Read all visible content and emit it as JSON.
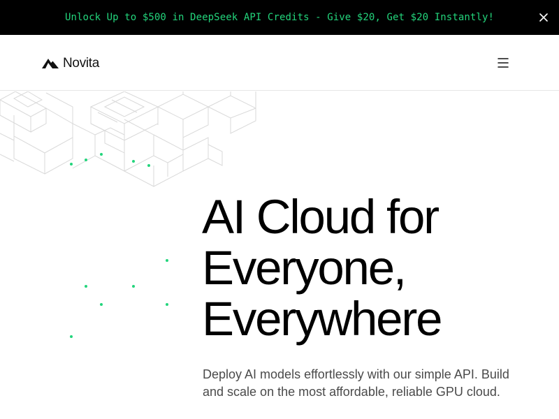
{
  "promo": {
    "text": "Unlock Up to $500 in DeepSeek API Credits - Give $20, Get $20 Instantly!",
    "close_icon": "close-icon",
    "text_color": "#23d57c",
    "background": "#000000"
  },
  "nav": {
    "logo_text": "Novita",
    "logo_icon": "mountain-logo-icon",
    "menu_icon": "hamburger-menu-icon"
  },
  "hero": {
    "title_lines": [
      "AI Cloud for",
      "Everyone,",
      "Everywhere"
    ],
    "subtitle_lines": [
      "Deploy AI models effortlessly with our simple API. Build",
      "and scale on the most affordable, reliable GPU cloud."
    ],
    "accent_color": "#23d57c"
  }
}
